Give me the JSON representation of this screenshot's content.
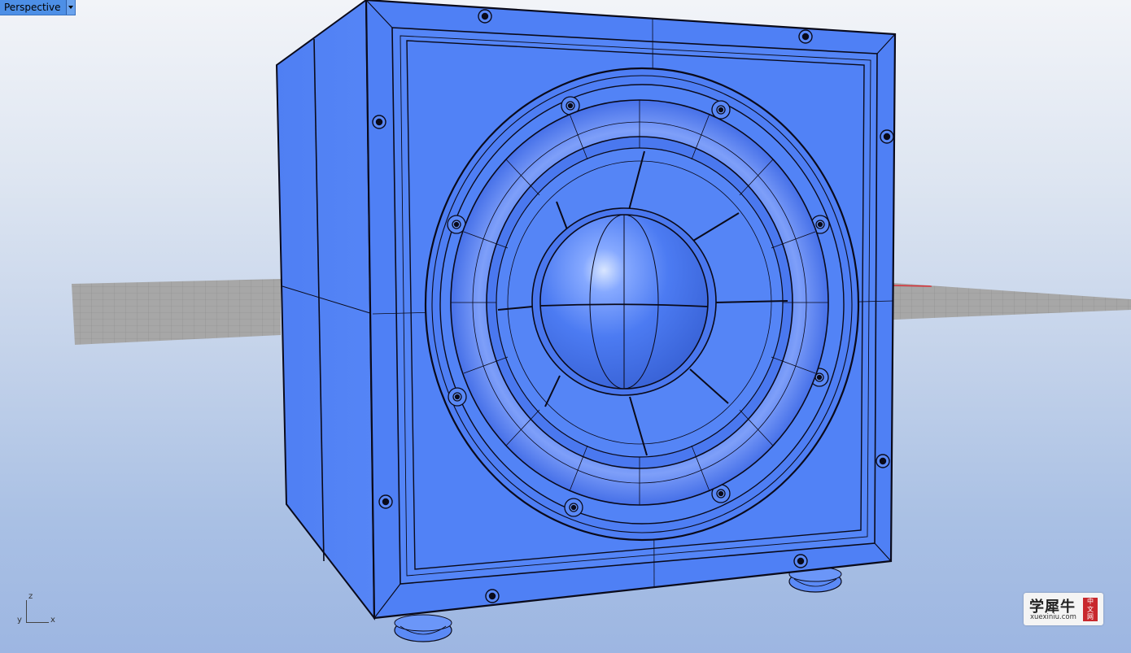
{
  "viewport": {
    "name": "Perspective",
    "dropdown_icon": "triangle-down-icon"
  },
  "axes": {
    "z": "z",
    "y": "y",
    "x": "x"
  },
  "watermark": {
    "chinese": "学犀牛",
    "url": "xuexiniu.com",
    "badge": [
      "中",
      "文",
      "网"
    ]
  },
  "colors": {
    "model_fill": "#4f7ff4",
    "model_edge": "#0a0a1a",
    "tab_bg": "#4d8fe6",
    "grid_gray": "#9a9a9a"
  }
}
